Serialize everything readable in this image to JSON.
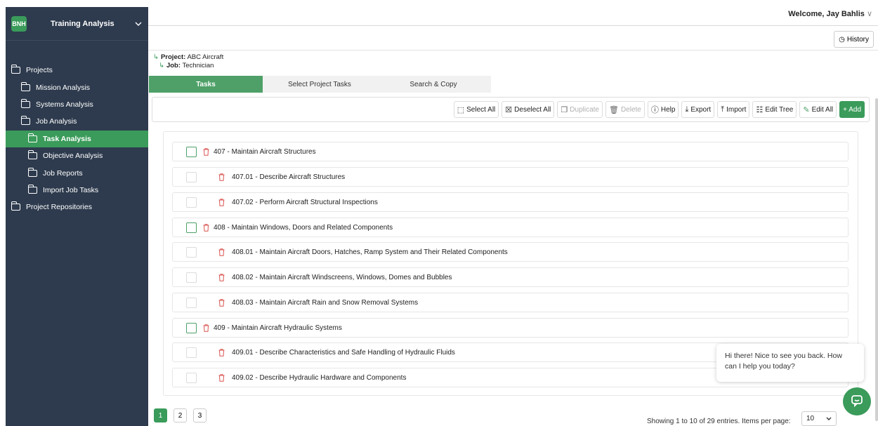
{
  "sidebar": {
    "logo": "BNH",
    "title": "Training Analysis",
    "items": [
      {
        "label": "Projects",
        "level": 0,
        "active": false
      },
      {
        "label": "Mission Analysis",
        "level": 1,
        "active": false
      },
      {
        "label": "Systems Analysis",
        "level": 1,
        "active": false
      },
      {
        "label": "Job Analysis",
        "level": 1,
        "active": false
      },
      {
        "label": "Task Analysis",
        "level": 2,
        "active": true
      },
      {
        "label": "Objective Analysis",
        "level": 2,
        "active": false
      },
      {
        "label": "Job Reports",
        "level": 2,
        "active": false
      },
      {
        "label": "Import Job Tasks",
        "level": 2,
        "active": false
      },
      {
        "label": "Project Repositories",
        "level": 0,
        "active": false
      }
    ]
  },
  "header": {
    "welcome": "Welcome, Jay Bahlis",
    "history_label": "History"
  },
  "breadcrumb": {
    "project_key": "Project:",
    "project_value": "ABC Aircraft",
    "job_key": "Job:",
    "job_value": "Technician"
  },
  "tabs": [
    {
      "label": "Tasks",
      "active": true
    },
    {
      "label": "Select Project Tasks",
      "active": false
    },
    {
      "label": "Search & Copy",
      "active": false
    }
  ],
  "toolbar": {
    "select_all": "Select All",
    "deselect_all": "Deselect All",
    "duplicate": "Duplicate",
    "delete": "Delete",
    "help": "Help",
    "export": "Export",
    "import": "Import",
    "edit_tree": "Edit Tree",
    "edit_all": "Edit All",
    "add": "+ Add"
  },
  "tasks": [
    {
      "label": "407 - Maintain Aircraft Structures",
      "parent": true
    },
    {
      "label": "407.01 - Describe Aircraft Structures",
      "parent": false
    },
    {
      "label": "407.02 - Perform Aircraft Structural Inspections",
      "parent": false
    },
    {
      "label": "408 - Maintain Windows, Doors and Related Components",
      "parent": true
    },
    {
      "label": "408.01 - Maintain Aircraft Doors, Hatches, Ramp System and Their Related Components",
      "parent": false
    },
    {
      "label": "408.02 - Maintain Aircraft Windscreens, Windows, Domes and Bubbles",
      "parent": false
    },
    {
      "label": "408.03 - Maintain Aircraft Rain and Snow Removal Systems",
      "parent": false
    },
    {
      "label": "409 - Maintain Aircraft Hydraulic Systems",
      "parent": true
    },
    {
      "label": "409.01 - Describe Characteristics and Safe Handling of Hydraulic Fluids",
      "parent": false
    },
    {
      "label": "409.02 - Describe Hydraulic Hardware and Components",
      "parent": false
    }
  ],
  "pagination": {
    "pages": [
      "1",
      "2",
      "3"
    ],
    "current": "1",
    "showing": "Showing 1 to 10 of 29 entries. Items per page:",
    "per_page": "10"
  },
  "chat": {
    "message": "Hi there! Nice to see you back. How can I help you today?"
  }
}
